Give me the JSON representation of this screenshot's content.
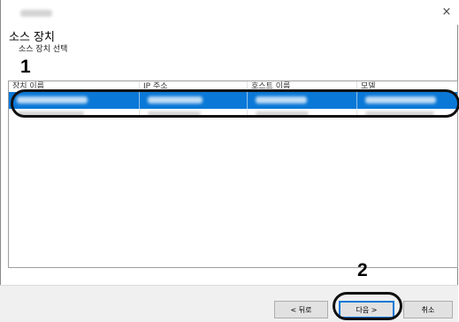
{
  "window": {
    "title": "",
    "close_glyph": "×"
  },
  "header": {
    "title": "소스 장치",
    "subtitle": "소스 장치 선택"
  },
  "callouts": {
    "first": "1",
    "second": "2"
  },
  "device_list": {
    "columns": [
      "장치 이름",
      "IP 주소",
      "호스트 이름",
      "모델"
    ],
    "rows": [
      {
        "selected": true,
        "values": [
          "",
          "",
          "",
          ""
        ]
      },
      {
        "selected": false,
        "values": [
          "",
          "",
          "",
          ""
        ]
      }
    ]
  },
  "footer": {
    "back_label": "< 뒤로",
    "next_label": "다음 >",
    "cancel_label": "취소"
  },
  "colors": {
    "selection": "#0a78d7",
    "callout_outline": "#111111"
  }
}
